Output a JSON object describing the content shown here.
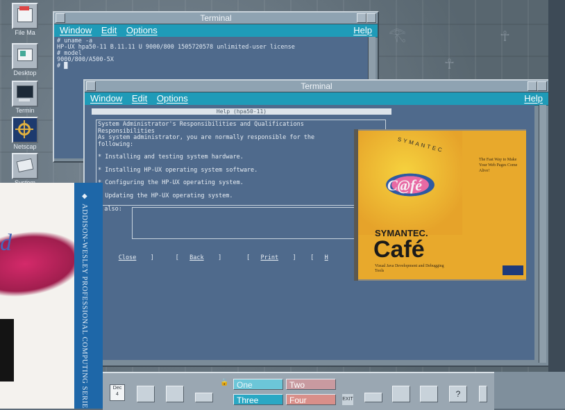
{
  "desktop": {
    "icons": [
      {
        "label": "File Ma",
        "icon": "file-manager-icon"
      },
      {
        "label": "Desktop",
        "icon": "desktop-icon"
      },
      {
        "label": "Termin",
        "icon": "terminal-icon"
      },
      {
        "label": "Netscap",
        "icon": "netscape-wheel-icon"
      },
      {
        "label": "System",
        "icon": "system-icon"
      }
    ]
  },
  "terminal_back": {
    "title": "Terminal",
    "menu": {
      "window": "Window",
      "edit": "Edit",
      "options": "Options",
      "help": "Help"
    },
    "lines": [
      "# uname -a",
      "HP-UX hpa50-11 B.11.11 U 9000/800 1505720578 unlimited-user license",
      "# model",
      "9000/800/A500-5X",
      "# █"
    ]
  },
  "terminal_front": {
    "title": "Terminal",
    "menu": {
      "window": "Window",
      "edit": "Edit",
      "options": "Options",
      "help": "Help"
    }
  },
  "help_dialog": {
    "title": "Help (hpa50-11)",
    "heading": "System Administrator's Responsibilities and Qualifications",
    "subheading": "Responsibilities",
    "intro": "As system administrator, you are normally responsible for the\nfollowing:",
    "bullets": [
      "* Installing and testing system hardware.",
      "* Installing HP-UX operating system software.",
      "* Configuring the HP-UX operating system.",
      "* Updating the HP-UX operating system."
    ],
    "see_also_label": "e also:",
    "buttons": {
      "close": "Close",
      "back": "Back",
      "print": "Print",
      "more": "H"
    }
  },
  "book": {
    "spine_text": "ADDISON-WESLEY PROFESSIONAL COMPUTING SERIES",
    "letter": "d"
  },
  "cafe_cd": {
    "arc_text": "SYMANTEC",
    "logo_text": "C@fé",
    "brand": "SYMANTEC.",
    "title": "Café",
    "blurb": "The Fast Way to Make Your Web Pages Come Alive!",
    "subtitle": "Visual Java Development and Debugging Tools"
  },
  "front_panel": {
    "calendar": {
      "month": "Dec",
      "day": "4"
    },
    "workspaces": [
      "One",
      "Two",
      "Three",
      "Four"
    ],
    "exit_label": "EXIT"
  }
}
